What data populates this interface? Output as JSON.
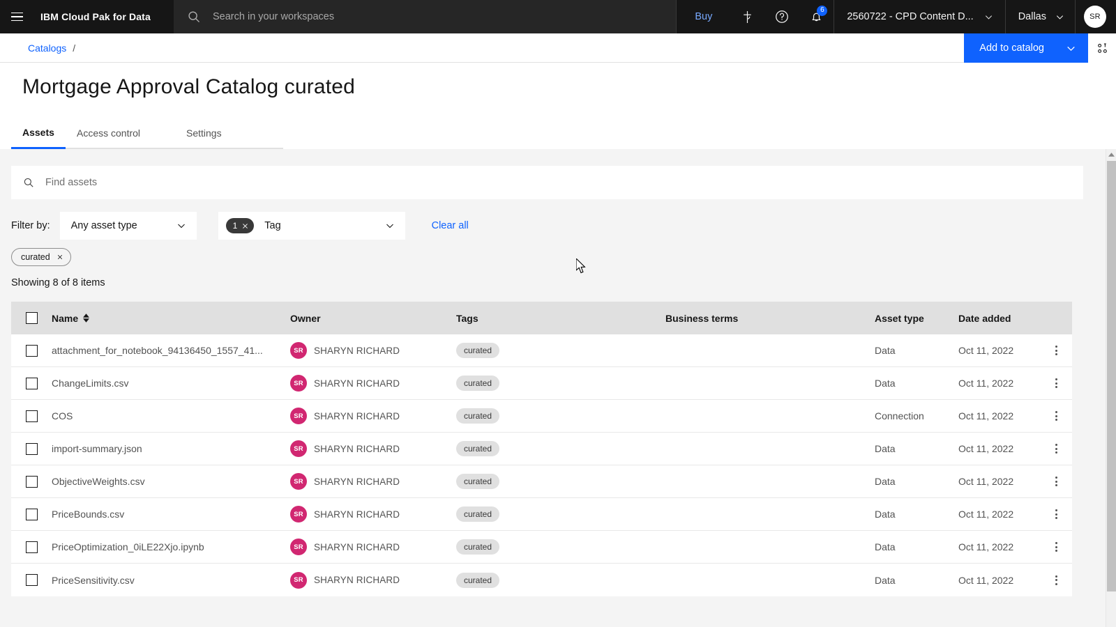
{
  "header": {
    "menu_icon": "hamburger-menu-icon",
    "brand_ibm": "IBM",
    "brand_rest": "Cloud Pak for Data",
    "search_placeholder": "Search in your workspaces",
    "search_value": "",
    "buy_label": "Buy",
    "notification_count": "6",
    "account_label": "2560722 - CPD Content D...",
    "region_label": "Dallas",
    "avatar_initials": "SR"
  },
  "breadcrumb": {
    "items": [
      {
        "label": "Catalogs",
        "link": true
      },
      {
        "label": "/",
        "link": false
      }
    ],
    "add_to_catalog_label": "Add to catalog"
  },
  "page": {
    "title": "Mortgage Approval Catalog curated",
    "tabs": [
      {
        "label": "Assets",
        "active": true
      },
      {
        "label": "Access control",
        "active": false
      },
      {
        "label": "Settings",
        "active": false
      }
    ]
  },
  "toolbar": {
    "search_placeholder": "Find assets",
    "search_value": "",
    "filter_by_label": "Filter by:",
    "asset_type_value": "Any asset type",
    "tag_count": "1",
    "tag_label": "Tag",
    "clear_all_label": "Clear all",
    "chips": [
      {
        "label": "curated"
      }
    ],
    "showing_label": "Showing 8 of 8 items"
  },
  "table": {
    "columns": [
      "Name",
      "Owner",
      "Tags",
      "Business terms",
      "Asset type",
      "Date added"
    ],
    "rows": [
      {
        "name": "attachment_for_notebook_94136450_1557_41...",
        "owner": "SHARYN RICHARD",
        "owner_initials": "SR",
        "tag": "curated",
        "business_terms": "",
        "asset_type": "Data",
        "date_added": "Oct 11, 2022"
      },
      {
        "name": "ChangeLimits.csv",
        "owner": "SHARYN RICHARD",
        "owner_initials": "SR",
        "tag": "curated",
        "business_terms": "",
        "asset_type": "Data",
        "date_added": "Oct 11, 2022"
      },
      {
        "name": "COS",
        "owner": "SHARYN RICHARD",
        "owner_initials": "SR",
        "tag": "curated",
        "business_terms": "",
        "asset_type": "Connection",
        "date_added": "Oct 11, 2022"
      },
      {
        "name": "import-summary.json",
        "owner": "SHARYN RICHARD",
        "owner_initials": "SR",
        "tag": "curated",
        "business_terms": "",
        "asset_type": "Data",
        "date_added": "Oct 11, 2022"
      },
      {
        "name": "ObjectiveWeights.csv",
        "owner": "SHARYN RICHARD",
        "owner_initials": "SR",
        "tag": "curated",
        "business_terms": "",
        "asset_type": "Data",
        "date_added": "Oct 11, 2022"
      },
      {
        "name": "PriceBounds.csv",
        "owner": "SHARYN RICHARD",
        "owner_initials": "SR",
        "tag": "curated",
        "business_terms": "",
        "asset_type": "Data",
        "date_added": "Oct 11, 2022"
      },
      {
        "name": "PriceOptimization_0iLE22Xjo.ipynb",
        "owner": "SHARYN RICHARD",
        "owner_initials": "SR",
        "tag": "curated",
        "business_terms": "",
        "asset_type": "Data",
        "date_added": "Oct 11, 2022"
      },
      {
        "name": "PriceSensitivity.csv",
        "owner": "SHARYN RICHARD",
        "owner_initials": "SR",
        "tag": "curated",
        "business_terms": "",
        "asset_type": "Data",
        "date_added": "Oct 11, 2022"
      }
    ]
  },
  "colors": {
    "header_bg": "#161616",
    "search_bg": "#262626",
    "accent_blue": "#0f62fe",
    "link_blue": "#78a9ff",
    "avatar_pink": "#d12771",
    "page_bg": "#f4f4f4",
    "table_head_bg": "#e0e0e0"
  }
}
